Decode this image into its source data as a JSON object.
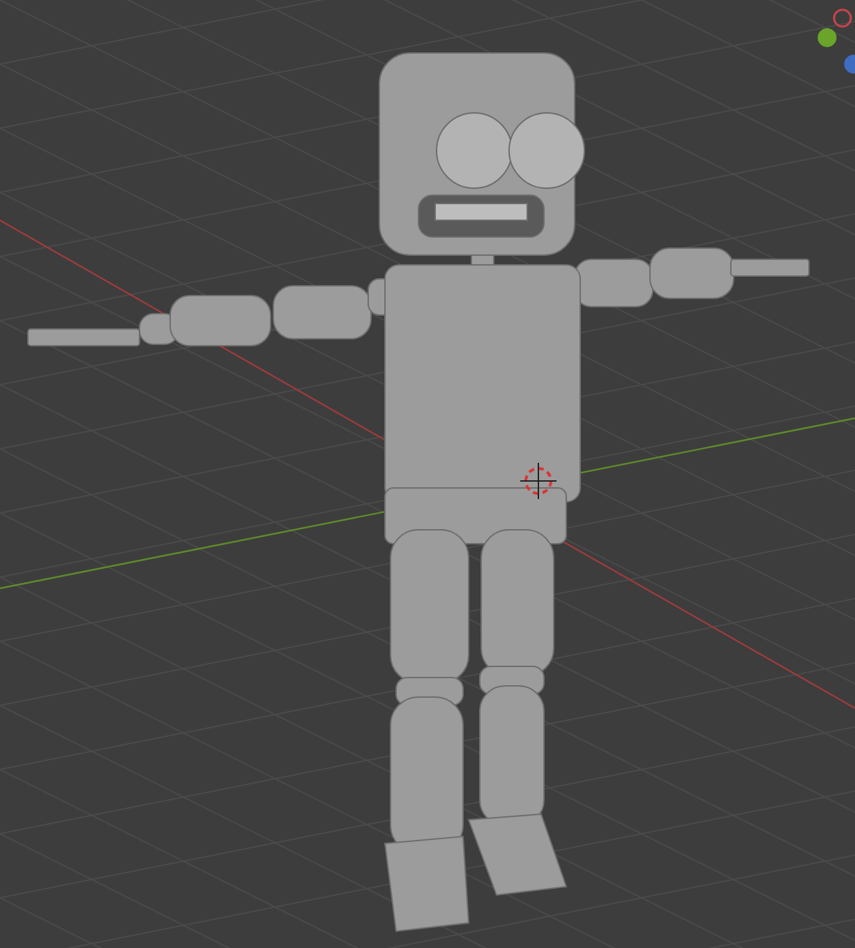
{
  "viewport": {
    "axis_lines": [
      {
        "kind": "x",
        "color": "#9a3c3c"
      },
      {
        "kind": "y",
        "color": "#5f8a2a"
      }
    ],
    "gizmo": {
      "axes": [
        {
          "kind": "y",
          "color": "#6aa52a"
        },
        {
          "kind": "x",
          "color": "#c9434b"
        },
        {
          "kind": "z",
          "color": "#3f6dc2"
        }
      ]
    }
  }
}
